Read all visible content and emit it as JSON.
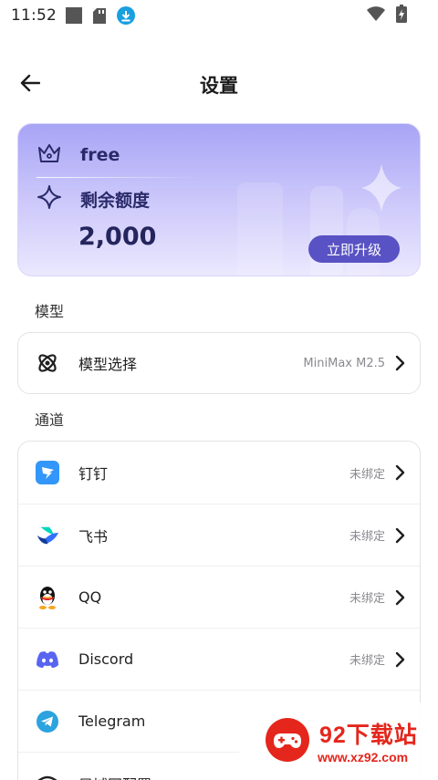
{
  "status_bar": {
    "time": "11:52",
    "left_icons": [
      "stop-square-icon",
      "sd-card-icon",
      "download-icon"
    ],
    "right_icons": [
      "wifi-icon",
      "battery-charging-icon"
    ]
  },
  "header": {
    "back_icon": "arrow-left-icon",
    "title": "设置"
  },
  "plan_card": {
    "tier": "free",
    "tier_icon": "crown-icon",
    "quota_label": "剩余额度",
    "quota_icon": "sparkle-icon",
    "quota_amount": "2,000",
    "upgrade_label": "立即升级",
    "colors": {
      "gradient_top": "#a8a4f6",
      "gradient_bottom": "#ebe8fe",
      "button": "#5952c4"
    }
  },
  "model_section": {
    "label": "模型",
    "items": [
      {
        "label": "模型选择",
        "value": "MiniMax M2.5",
        "icon": "atom-icon"
      }
    ]
  },
  "channel_section": {
    "label": "通道",
    "items": [
      {
        "label": "钉钉",
        "value": "未绑定",
        "icon": "dingtalk-icon"
      },
      {
        "label": "飞书",
        "value": "未绑定",
        "icon": "feishu-icon"
      },
      {
        "label": "QQ",
        "value": "未绑定",
        "icon": "qq-icon"
      },
      {
        "label": "Discord",
        "value": "未绑定",
        "icon": "discord-icon"
      },
      {
        "label": "Telegram",
        "value": "",
        "icon": "telegram-icon"
      },
      {
        "label": "局域网配置",
        "value": "",
        "icon": "wifi-icon"
      }
    ]
  },
  "watermark": {
    "title": "92下载站",
    "url": "www.xz92.com"
  }
}
